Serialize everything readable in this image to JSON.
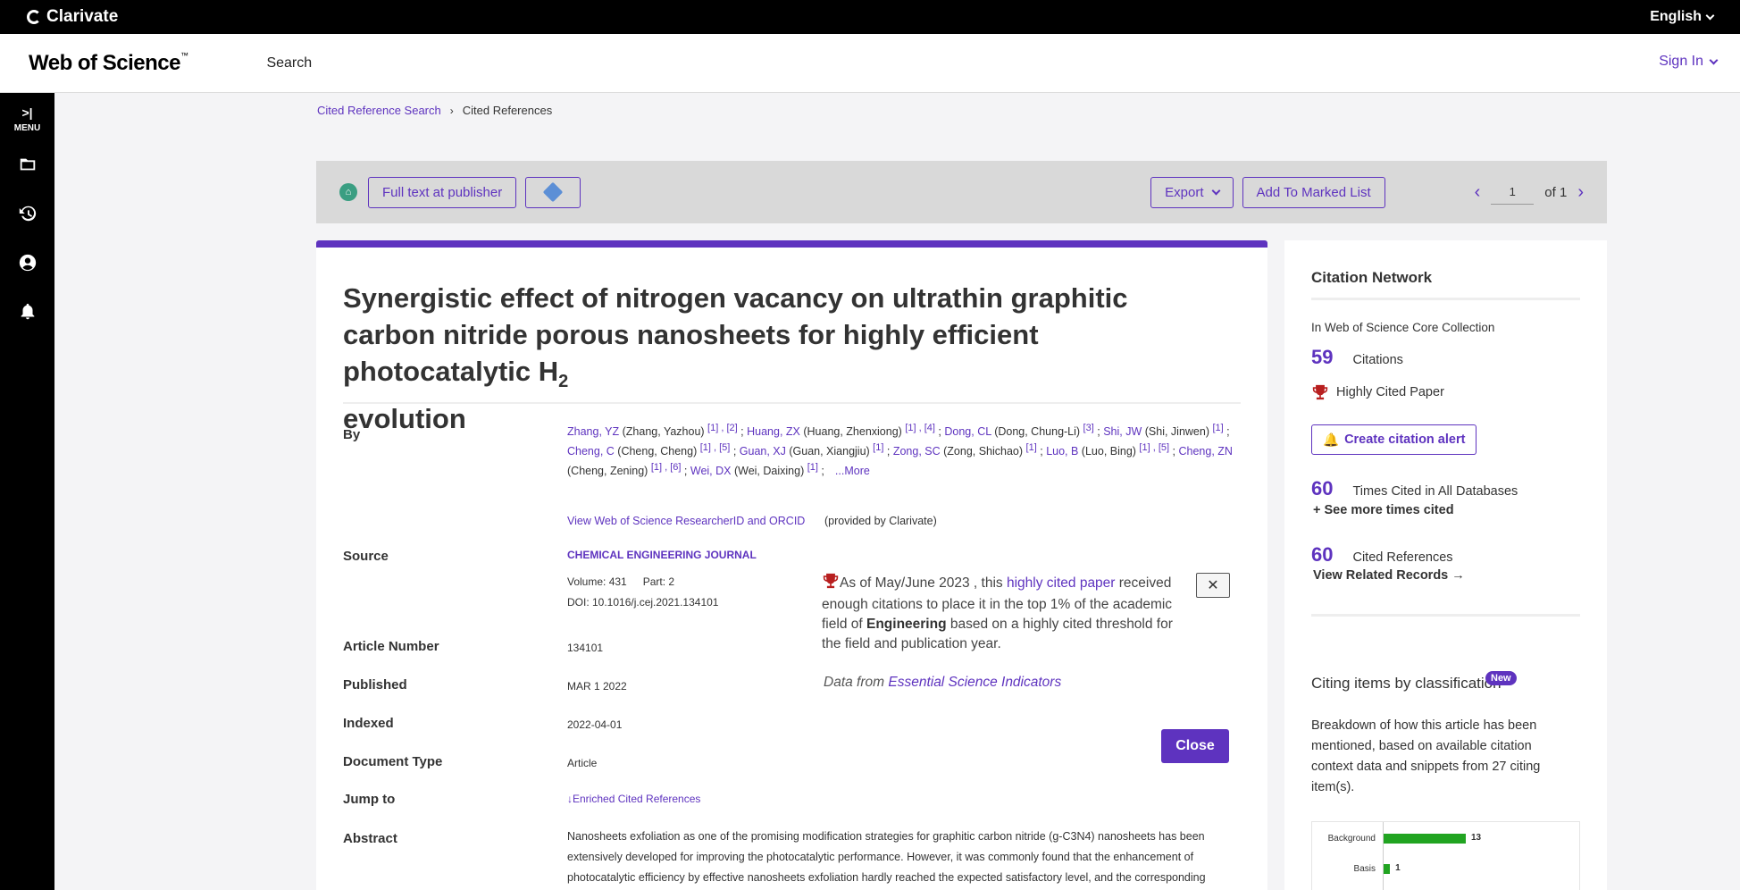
{
  "brand": {
    "clarivate": "Clarivate",
    "language": "English"
  },
  "header": {
    "product": "Web of Science",
    "tm": "™",
    "search": "Search",
    "signin": "Sign In"
  },
  "rail": {
    "menu_label": "MENU"
  },
  "breadcrumb": {
    "parent": "Cited Reference Search",
    "separator": "›",
    "current": "Cited References"
  },
  "toolbar": {
    "full_text": "Full text at publisher",
    "export": "Export",
    "marked_list": "Add To Marked List",
    "page_value": "1",
    "page_of": "of 1"
  },
  "record": {
    "title_main": "Synergistic effect of nitrogen vacancy on ultrathin graphitic carbon nitride porous nanosheets for highly efficient photocatalytic H",
    "title_sub": "2",
    "title_end": "evolution",
    "labels": {
      "by": "By",
      "source": "Source",
      "article_number": "Article Number",
      "published": "Published",
      "indexed": "Indexed",
      "document_type": "Document Type",
      "jump_to": "Jump to",
      "abstract": "Abstract"
    },
    "authors": [
      {
        "short": "Zhang, YZ",
        "full": " (Zhang, Yazhou) ",
        "refs": "[1] , [2]"
      },
      {
        "short": "Huang, ZX",
        "full": " (Huang, Zhenxiong) ",
        "refs": "[1] , [4]"
      },
      {
        "short": "Dong, CL",
        "full": " (Dong, Chung-Li) ",
        "refs": "[3]"
      },
      {
        "short": "Shi, JW",
        "full": " (Shi, Jinwen) ",
        "refs": "[1]"
      },
      {
        "short": "Cheng, C",
        "full": " (Cheng, Cheng) ",
        "refs": "[1] , [5]"
      },
      {
        "short": "Guan, XJ",
        "full": " (Guan, Xiangjiu) ",
        "refs": "[1]"
      },
      {
        "short": "Zong, SC",
        "full": " (Zong, Shichao) ",
        "refs": "[1]"
      },
      {
        "short": "Luo, B",
        "full": " (Luo, Bing) ",
        "refs": "[1] , [5]"
      },
      {
        "short": "Cheng, ZN",
        "full": " (Cheng, Zening) ",
        "refs": "[1] , [6]"
      },
      {
        "short": "Wei, DX",
        "full": " (Wei, Daixing) ",
        "refs": "[1]"
      }
    ],
    "more": "...More",
    "researcher_link": "View Web of Science ResearcherID and ORCID",
    "researcher_note": "(provided by Clarivate)",
    "journal": "CHEMICAL ENGINEERING JOURNAL",
    "volume": "Volume: 431",
    "part": "Part: 2",
    "doi": "DOI: 10.1016/j.cej.2021.134101",
    "article_number": "134101",
    "published": "MAR 1 2022",
    "indexed": "2022-04-01",
    "document_type": "Article",
    "jump_link": "Enriched Cited References",
    "abstract": "Nanosheets exfoliation as one of the promising modification strategies for graphitic carbon nitride (g-C3N4) nanosheets has been extensively developed for improving the photocatalytic performance. However, it was commonly found that the enhancement of photocatalytic efficiency by effective nanosheets exfoliation hardly reached the expected satisfactory level, and the corresponding"
  },
  "highly_cited": {
    "prefix": "As of May/June 2023 , this ",
    "link": "highly cited paper",
    "middle": " received enough citations to place it in the top 1% of the academic field of ",
    "field": "Engineering",
    "suffix": " based on a highly cited threshold for the field and publication year.",
    "source_prefix": "Data from ",
    "source_link": "Essential Science Indicators",
    "close_x": "✕",
    "close": "Close"
  },
  "citation_network": {
    "title": "Citation Network",
    "collection": "In Web of Science Core Collection",
    "citations_num": "59",
    "citations_label": "Citations",
    "highly_cited": "Highly Cited Paper",
    "alert": "Create citation alert",
    "times_cited_num": "60",
    "times_cited_label": "Times Cited in All Databases",
    "see_more": "+ See more times cited",
    "cited_refs_num": "60",
    "cited_refs_label": "Cited References",
    "related": "View Related Records →",
    "classif_title": "Citing items by classification",
    "new_badge": "New",
    "classif_desc": "Breakdown of how this article has been mentioned, based on available citation context data and snippets from 27 citing item(s)."
  },
  "chart_data": {
    "type": "bar",
    "categories": [
      "Background",
      "Basis"
    ],
    "values": [
      13,
      1
    ],
    "xlim": [
      0,
      13
    ]
  },
  "colors": {
    "accent": "#5e33bf",
    "bar": "#21a421"
  }
}
